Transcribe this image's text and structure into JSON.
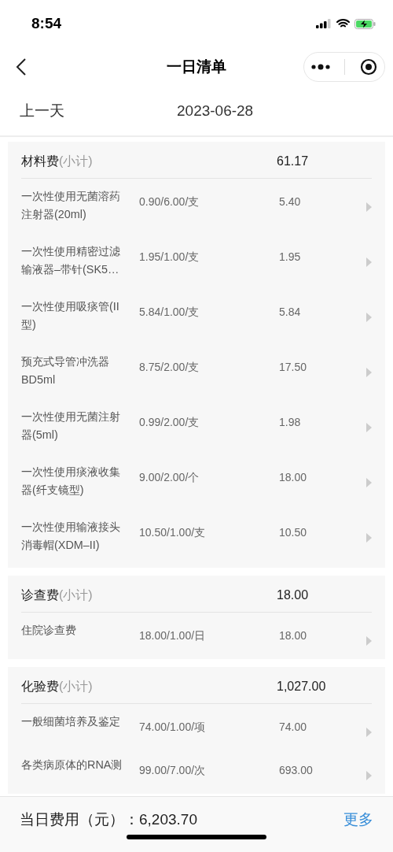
{
  "status_bar": {
    "time": "8:54"
  },
  "nav": {
    "title": "一日清单"
  },
  "date_bar": {
    "prev": "上一天",
    "date": "2023-06-28"
  },
  "sections": [
    {
      "title": "材料费",
      "subtitle": "(小计)",
      "total": "61.17",
      "items": [
        {
          "name": "一次性使用无菌溶药注射器(20ml)",
          "price": "0.90/6.00/支",
          "amount": "5.40"
        },
        {
          "name": "一次性使用精密过滤输液器–带针(SK5…",
          "price": "1.95/1.00/支",
          "amount": "1.95"
        },
        {
          "name": "一次性使用吸痰管(II型)",
          "price": "5.84/1.00/支",
          "amount": "5.84"
        },
        {
          "name": "预充式导管冲洗器BD5ml",
          "price": "8.75/2.00/支",
          "amount": "17.50"
        },
        {
          "name": "一次性使用无菌注射器(5ml)",
          "price": "0.99/2.00/支",
          "amount": "1.98"
        },
        {
          "name": "一次性使用痰液收集器(纤支镜型)",
          "price": "9.00/2.00/个",
          "amount": "18.00"
        },
        {
          "name": "一次性使用输液接头消毒帽(XDM–II)",
          "price": "10.50/1.00/支",
          "amount": "10.50"
        }
      ]
    },
    {
      "title": "诊查费",
      "subtitle": "(小计)",
      "total": "18.00",
      "items": [
        {
          "name": "住院诊查费",
          "price": "18.00/1.00/日",
          "amount": "18.00"
        }
      ]
    },
    {
      "title": "化验费",
      "subtitle": "(小计)",
      "total": "1,027.00",
      "items": [
        {
          "name": "一般细菌培养及鉴定",
          "price": "74.00/1.00/项",
          "amount": "74.00"
        },
        {
          "name": "各类病原体的RNA测",
          "price": "99.00/7.00/次",
          "amount": "693.00"
        }
      ]
    }
  ],
  "footer": {
    "label": "当日费用（元）：",
    "total": "6,203.70",
    "more": "更多"
  }
}
